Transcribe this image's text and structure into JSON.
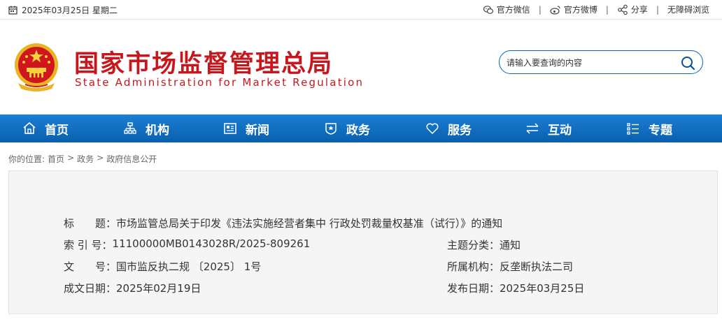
{
  "topbar": {
    "date": "2025年03月25日 星期二",
    "links": [
      {
        "label": "官方微信",
        "icon": "wechat-icon"
      },
      {
        "label": "官方微博",
        "icon": "weibo-icon"
      },
      {
        "label": "分享",
        "icon": "share-icon"
      },
      {
        "label": "无障碍浏览",
        "icon": ""
      }
    ],
    "separator": "|"
  },
  "header": {
    "title": "国家市场监督管理总局",
    "subtitle": "State Administration for Market Regulation",
    "search_placeholder": "请输入要查询的内容"
  },
  "nav": {
    "items": [
      {
        "label": "首页",
        "icon": "home-icon"
      },
      {
        "label": "机构",
        "icon": "org-chart-icon"
      },
      {
        "label": "新闻",
        "icon": "newspaper-icon"
      },
      {
        "label": "政务",
        "icon": "government-icon"
      },
      {
        "label": "服务",
        "icon": "heart-icon"
      },
      {
        "label": "互动",
        "icon": "exchange-icon"
      },
      {
        "label": "专题",
        "icon": "topics-icon"
      }
    ]
  },
  "breadcrumb": {
    "prefix": "你的位置:",
    "items": [
      "首页",
      "政务",
      "政府信息公开"
    ],
    "separator": ">"
  },
  "info": {
    "title_label": "标　　题：",
    "title_value": "市场监管总局关于印发《违法实施经营者集中 行政处罚裁量权基准（试行）》的通知",
    "index_label": "索 引 号：",
    "index_value": "11100000MB0143028R/2025-809261",
    "category_label": "主题分类：",
    "category_value": "通知",
    "docno_label": "文　　号：",
    "docno_value": "国市监反执二规 〔2025〕 1号",
    "agency_label": "所属机构：",
    "agency_value": "反垄断执法二司",
    "written_label": "成文日期：",
    "written_value": "2025年02月19日",
    "published_label": "发布日期：",
    "published_value": "2025年03月25日"
  },
  "colors": {
    "brand_red": "#c8161d",
    "nav_blue": "#0a5fae",
    "accent_blue": "#0a63b8"
  }
}
